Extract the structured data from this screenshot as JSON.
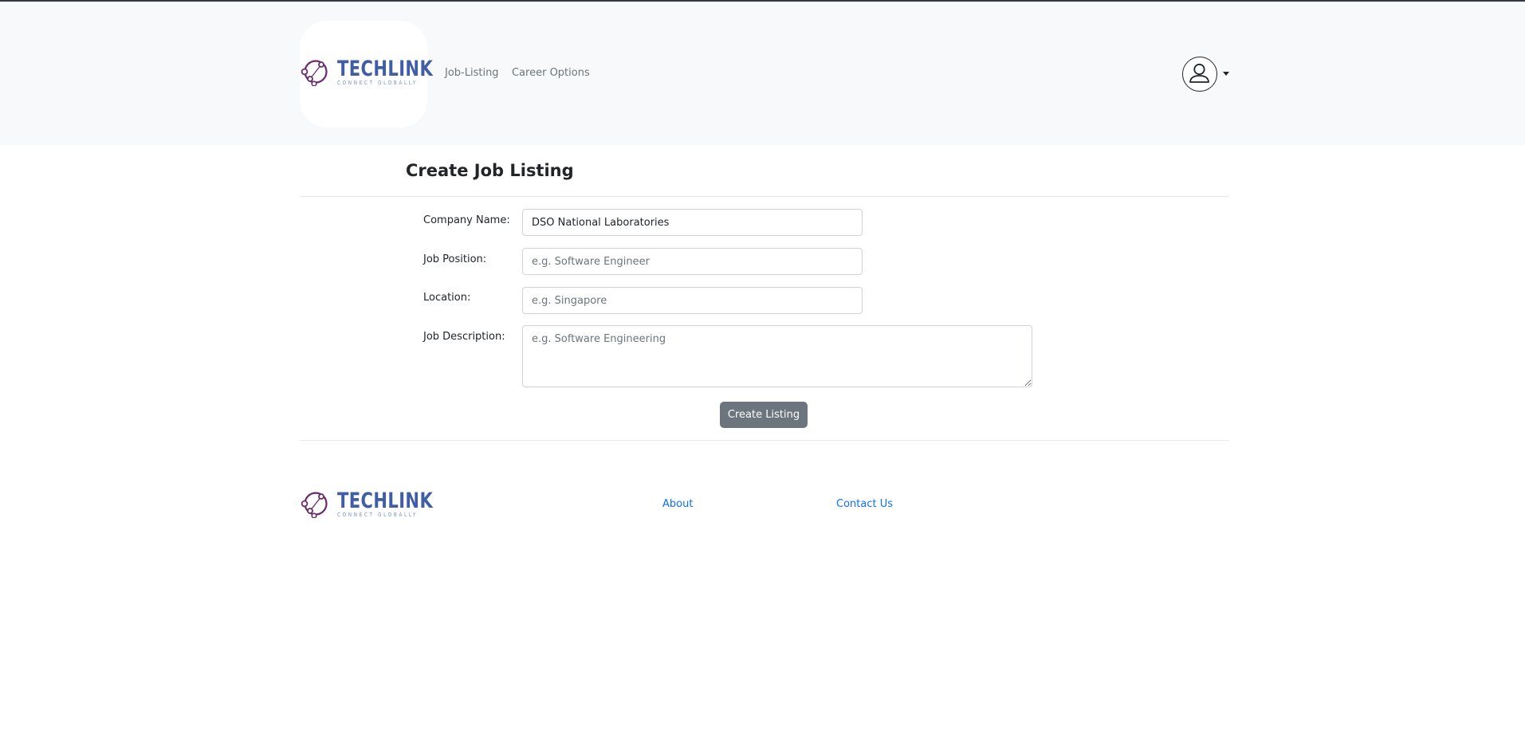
{
  "brand": {
    "name": "TECHLINK",
    "tagline": "CONNECT GLOBALLY",
    "primary_color": "#3f5ea6",
    "accent_color": "#6b2a6e",
    "icon": "linked-nodes-logo-icon"
  },
  "navbar": {
    "links": [
      {
        "label": "Job-Listing"
      },
      {
        "label": "Career Options"
      }
    ],
    "profile": {
      "icon": "user-avatar-icon",
      "menu_icon": "caret-down-icon"
    }
  },
  "page": {
    "title": "Create Job Listing"
  },
  "form": {
    "company": {
      "label": "Company Name:",
      "value": "DSO National Laboratories",
      "placeholder": ""
    },
    "position": {
      "label": "Job Position:",
      "value": "",
      "placeholder": "e.g. Software Engineer"
    },
    "location": {
      "label": "Location:",
      "value": "",
      "placeholder": "e.g. Singapore"
    },
    "description": {
      "label": "Job Description:",
      "value": "",
      "placeholder": "e.g. Software Engineering"
    },
    "submit_label": "Create Listing",
    "submit_color": "#6c757d"
  },
  "footer": {
    "links": [
      {
        "label": "About"
      },
      {
        "label": "Contact Us"
      }
    ],
    "link_color": "#0d6efd"
  }
}
